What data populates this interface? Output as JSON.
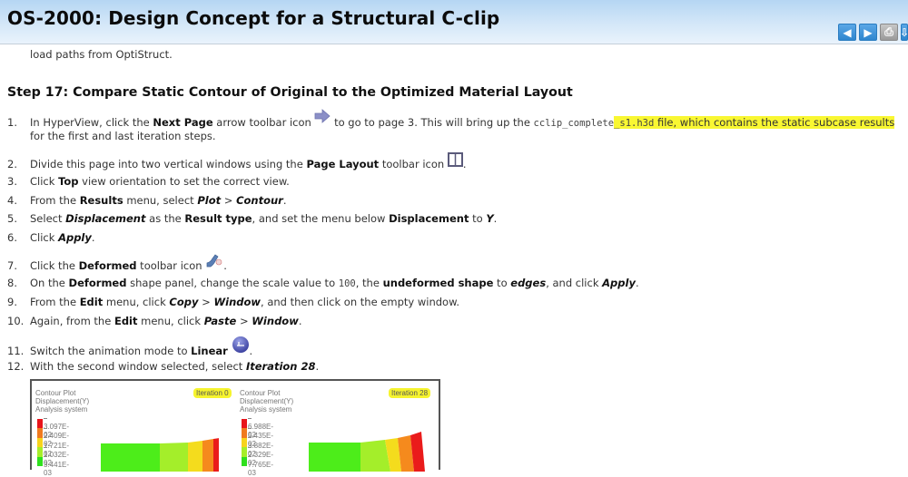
{
  "header": {
    "title": "OS-2000: Design Concept for a Structural C-clip",
    "nav_buttons": [
      {
        "name": "previous-page",
        "glyph": "◀"
      },
      {
        "name": "next-page",
        "glyph": "▶"
      },
      {
        "name": "print",
        "glyph": "⎙"
      },
      {
        "name": "download",
        "glyph": "⇩"
      }
    ]
  },
  "intro_text": "load paths from OptiStruct.",
  "step": {
    "title": "Step 17:  Compare Static Contour of Original to the Optimized Material Layout",
    "items": [
      {
        "num": "1.",
        "parts": {
          "a": "In HyperView, click the ",
          "b": "Next Page",
          "c": " arrow toolbar icon ",
          "d": " to go to page 3. This will bring up the ",
          "code1": "cclip_complete",
          "code2": "_s1.h3d",
          "e": " file, which contains the static subcase results",
          "f": "for the first and last iteration steps."
        }
      },
      {
        "num": "2.",
        "parts": {
          "a": "Divide this page into two vertical windows using the ",
          "b": "Page Layout",
          "c": " toolbar icon ",
          "d": "."
        }
      },
      {
        "num": "3.",
        "parts": {
          "a": "Click ",
          "b": "Top",
          "c": " view orientation to set the correct view."
        }
      },
      {
        "num": "4.",
        "parts": {
          "a": "From the ",
          "b": "Results",
          "c": " menu, select ",
          "d": "Plot",
          "e": " > ",
          "f": "Contour",
          "g": "."
        }
      },
      {
        "num": "5.",
        "parts": {
          "a": "Select ",
          "b": "Displacement",
          "c": " as the ",
          "d": "Result type",
          "e": ", and set the menu below ",
          "f": "Displacement",
          "g": " to ",
          "h": "Y",
          "i": "."
        }
      },
      {
        "num": "6.",
        "parts": {
          "a": "Click ",
          "b": "Apply",
          "c": "."
        }
      },
      {
        "num": "7.",
        "parts": {
          "a": "Click the ",
          "b": "Deformed",
          "c": " toolbar icon ",
          "d": "."
        }
      },
      {
        "num": "8.",
        "parts": {
          "a": "On the ",
          "b": "Deformed",
          "c": " shape panel, change the scale value to ",
          "code": "100",
          "d": ", the ",
          "e": "undeformed shape",
          "f": " to ",
          "g": "edges",
          "h": ", and click ",
          "i": "Apply",
          "j": "."
        }
      },
      {
        "num": "9.",
        "parts": {
          "a": "From the ",
          "b": "Edit",
          "c": " menu, click ",
          "d": "Copy",
          "e": " > ",
          "f": "Window",
          "g": ", and then click on the empty window."
        }
      },
      {
        "num": "10.",
        "parts": {
          "a": "Again, from the ",
          "b": "Edit",
          "c": " menu, click ",
          "d": "Paste",
          "e": " > ",
          "f": "Window",
          "g": "."
        }
      },
      {
        "num": "11.",
        "parts": {
          "a": "Switch the animation mode to ",
          "b": "Linear",
          "c": "."
        }
      },
      {
        "num": "12.",
        "parts": {
          "a": "With the second window selected, select ",
          "b": "Iteration 28",
          "c": "."
        }
      }
    ]
  },
  "figure": {
    "panels": [
      {
        "title_lines": [
          "Contour Plot",
          "Displacement(Y)",
          "Analysis system"
        ],
        "iteration_label": "Iteration 0",
        "legend_values": [
          "3.097E-02",
          "2.409E-02",
          "1.721E-02",
          "1.032E-02",
          "3.441E-03"
        ],
        "legend_colors": [
          "#e8141b",
          "#f07a1e",
          "#f7d31c",
          "#a6ee2a",
          "#2fe01e"
        ]
      },
      {
        "title_lines": [
          "Contour Plot",
          "Displacement(Y)",
          "Analysis system"
        ],
        "iteration_label": "Iteration 28",
        "legend_values": [
          "6.988E-02",
          "5.435E-02",
          "3.882E-02",
          "2.329E-02",
          "7.765E-03"
        ],
        "legend_colors": [
          "#e8141b",
          "#f07a1e",
          "#f7d31c",
          "#a6ee2a",
          "#2fe01e"
        ]
      }
    ],
    "contour_colors": [
      "#4ded1a",
      "#a4ee2a",
      "#f4dc1d",
      "#f58a1d",
      "#ea1b1b"
    ]
  },
  "colors": {
    "highlight": "#f9f732",
    "header_gradient_top": "#b5d6f3",
    "nav_button_blue": "#2f86cf"
  }
}
